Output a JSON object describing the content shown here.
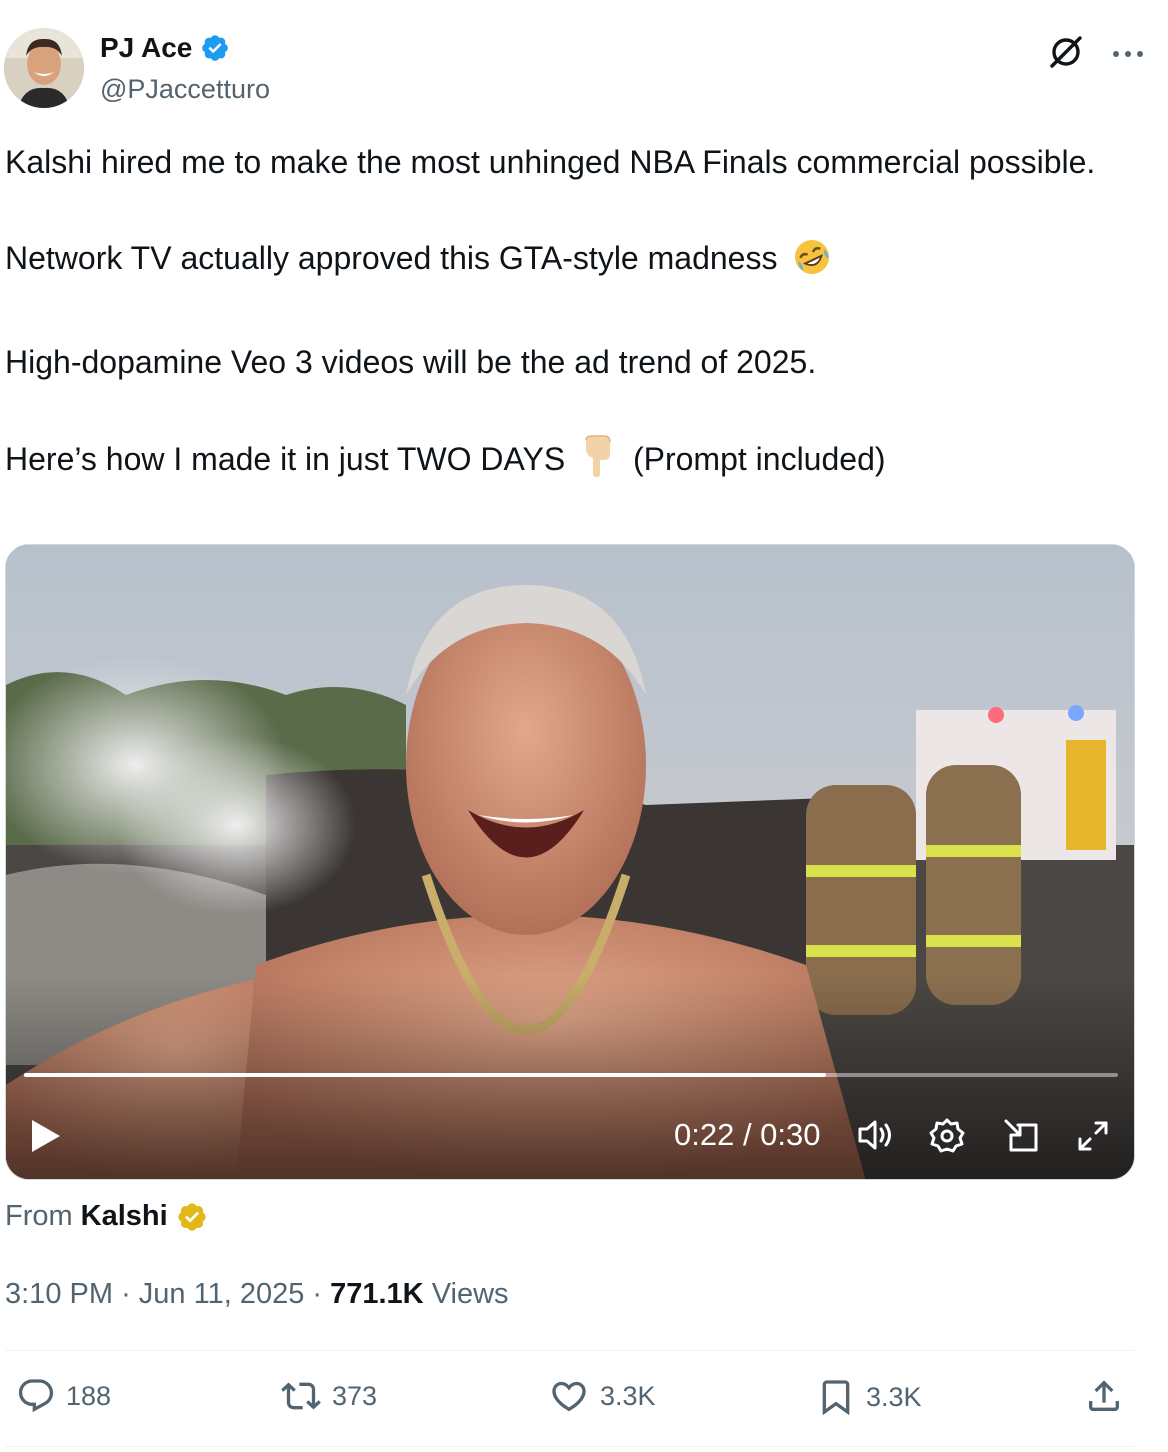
{
  "author": {
    "name": "PJ Ace",
    "handle": "@PJaccetturo",
    "verified": true,
    "verified_color": "#1d9bf0"
  },
  "header_icons": [
    "grok-icon",
    "more-icon"
  ],
  "tweet": {
    "lines": [
      "Kalshi hired me to make the most unhinged NBA Finals commercial possible.",
      "Network TV actually approved this GTA-style madness",
      "High-dopamine Veo 3 videos will be the ad trend of 2025.",
      "Here’s how I made it in just TWO DAYS",
      "(Prompt included)"
    ],
    "emoji_1": "rolling-on-floor-laughing",
    "emoji_2": "backhand-index-pointing-down"
  },
  "video": {
    "time_display": "0:22 / 0:30",
    "progress": 0.733,
    "controls": [
      "play-icon",
      "volume-icon",
      "settings-icon",
      "picture-in-picture-icon",
      "fullscreen-icon"
    ]
  },
  "source": {
    "prefix": "From",
    "name": "Kalshi",
    "badge_color": "#e2b719"
  },
  "meta": {
    "time": "3:10 PM",
    "date": "Jun 11, 2025",
    "views_count": "771.1K",
    "views_label": "Views"
  },
  "actions": {
    "replies": "188",
    "reposts": "373",
    "likes": "3.3K",
    "bookmarks": "3.3K"
  },
  "colors": {
    "text": "#0f1419",
    "secondary": "#536471",
    "accent": "#1d9bf0"
  }
}
